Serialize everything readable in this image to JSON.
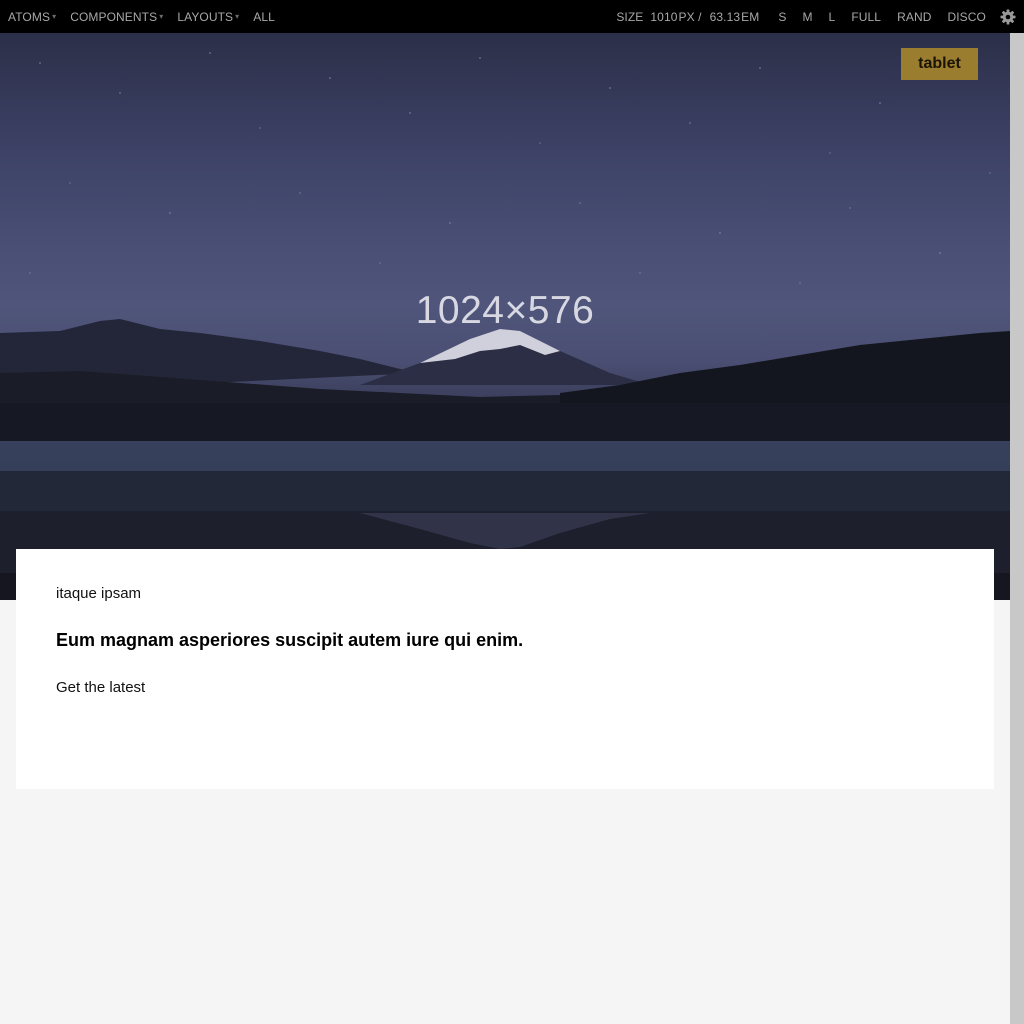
{
  "toolbar": {
    "nav": [
      {
        "label": "ATOMS",
        "has_caret": true
      },
      {
        "label": "COMPONENTS",
        "has_caret": true
      },
      {
        "label": "LAYOUTS",
        "has_caret": true
      },
      {
        "label": "ALL",
        "has_caret": false
      }
    ],
    "caret_glyph": "▾",
    "size_label": "SIZE",
    "size_px_value": "1010",
    "size_px_unit": "PX /",
    "size_em_value": "63.13",
    "size_em_unit": "EM",
    "viewport_buttons": [
      "S",
      "M",
      "L",
      "FULL",
      "RAND",
      "DISCO"
    ],
    "settings_icon": "gear-icon"
  },
  "hero": {
    "placeholder_label": "1024×576",
    "badge": "tablet"
  },
  "card": {
    "eyebrow": "itaque ipsam",
    "headline": "Eum magnam asperiores suscipit autem iure qui enim.",
    "cta": "Get the latest"
  },
  "colors": {
    "toolbar_bg": "#000000",
    "toolbar_text": "#a8a8a8",
    "page_bg": "#f5f5f5",
    "badge_bg": "#9a7d2e",
    "card_bg": "#ffffff"
  }
}
